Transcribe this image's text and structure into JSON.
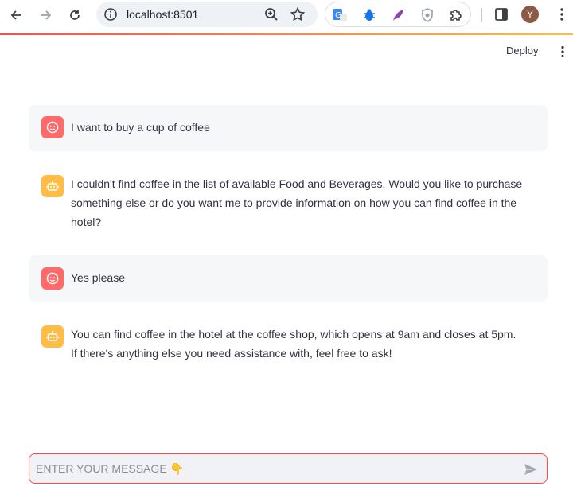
{
  "browser": {
    "url": "localhost:8501",
    "profile_initial": "Y"
  },
  "app": {
    "deploy_label": "Deploy"
  },
  "chat": {
    "messages": [
      {
        "role": "user",
        "text": "I want to buy a cup of coffee"
      },
      {
        "role": "assistant",
        "text": "I couldn't find coffee in the list of available Food and Beverages. Would you like to purchase something else or do you want me to provide information on how you can find coffee in the hotel?"
      },
      {
        "role": "user",
        "text": "Yes please"
      },
      {
        "role": "assistant",
        "text": "You can find coffee in the hotel at the coffee shop, which opens at 9am and closes at 5pm. If there's anything else you need assistance with, feel free to ask!"
      }
    ],
    "input_placeholder": "ENTER YOUR MESSAGE 👇",
    "input_value": ""
  },
  "colors": {
    "accent": "#ff4b4b",
    "user_avatar": "#ff6b6b",
    "bot_avatar": "#ffbd45",
    "user_bubble": "#f6f7f9"
  },
  "icons": {
    "back": "back-arrow-icon",
    "forward": "forward-arrow-icon",
    "reload": "reload-icon",
    "site_info": "info-icon",
    "zoom": "zoom-icon",
    "bookmark": "star-icon",
    "extensions": "puzzle-icon",
    "send": "send-icon"
  }
}
